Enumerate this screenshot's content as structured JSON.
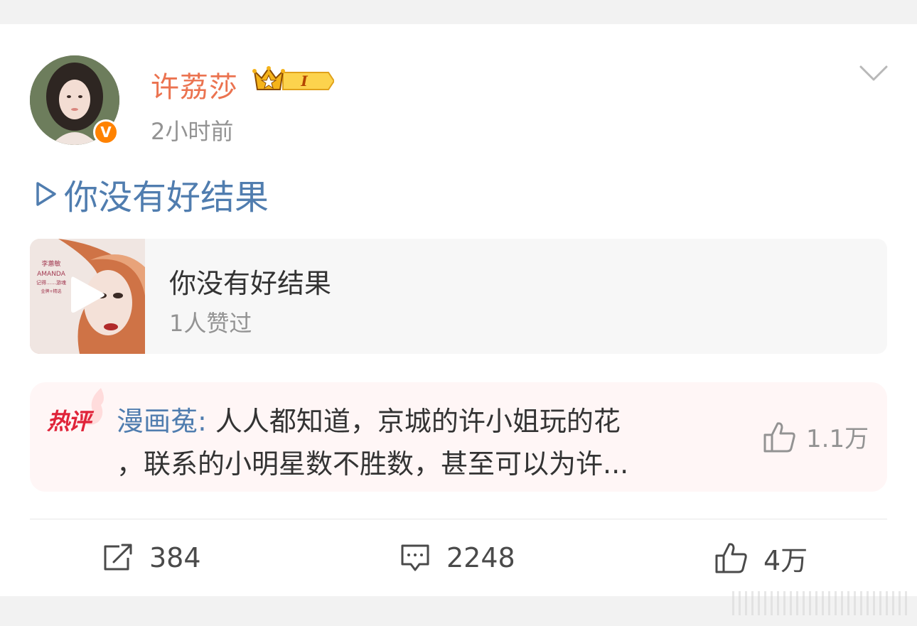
{
  "post": {
    "username": "许荔莎",
    "level_badge": "I",
    "time": "2小时前",
    "text": "你没有好结果"
  },
  "music_card": {
    "title": "你没有好结果",
    "subtitle": "1人赞过",
    "cover_text": {
      "artist": "李蕙敏",
      "english": "AMANDA",
      "album": "记得……游魂",
      "footer": "金牌+精选"
    }
  },
  "hot_comment": {
    "tag": "热评",
    "author": "漫画菟",
    "separator": ": ",
    "line1": "人人都知道，京城的许小姐玩的花",
    "line2": "，联系的小明星数不胜数，甚至可以为许...",
    "likes": "1.1万"
  },
  "actions": {
    "reposts": "384",
    "comments": "2248",
    "likes": "4万"
  },
  "colors": {
    "username": "#eb7350",
    "link": "#507daf",
    "verified": "#ff8200",
    "hot_tag": "#e0243a"
  },
  "icons": {
    "verified": "verified-v-icon",
    "crown": "crown-icon",
    "chevron": "chevron-down-icon",
    "play": "play-icon",
    "repost": "repost-icon",
    "comment": "comment-icon",
    "like": "thumb-up-icon"
  }
}
